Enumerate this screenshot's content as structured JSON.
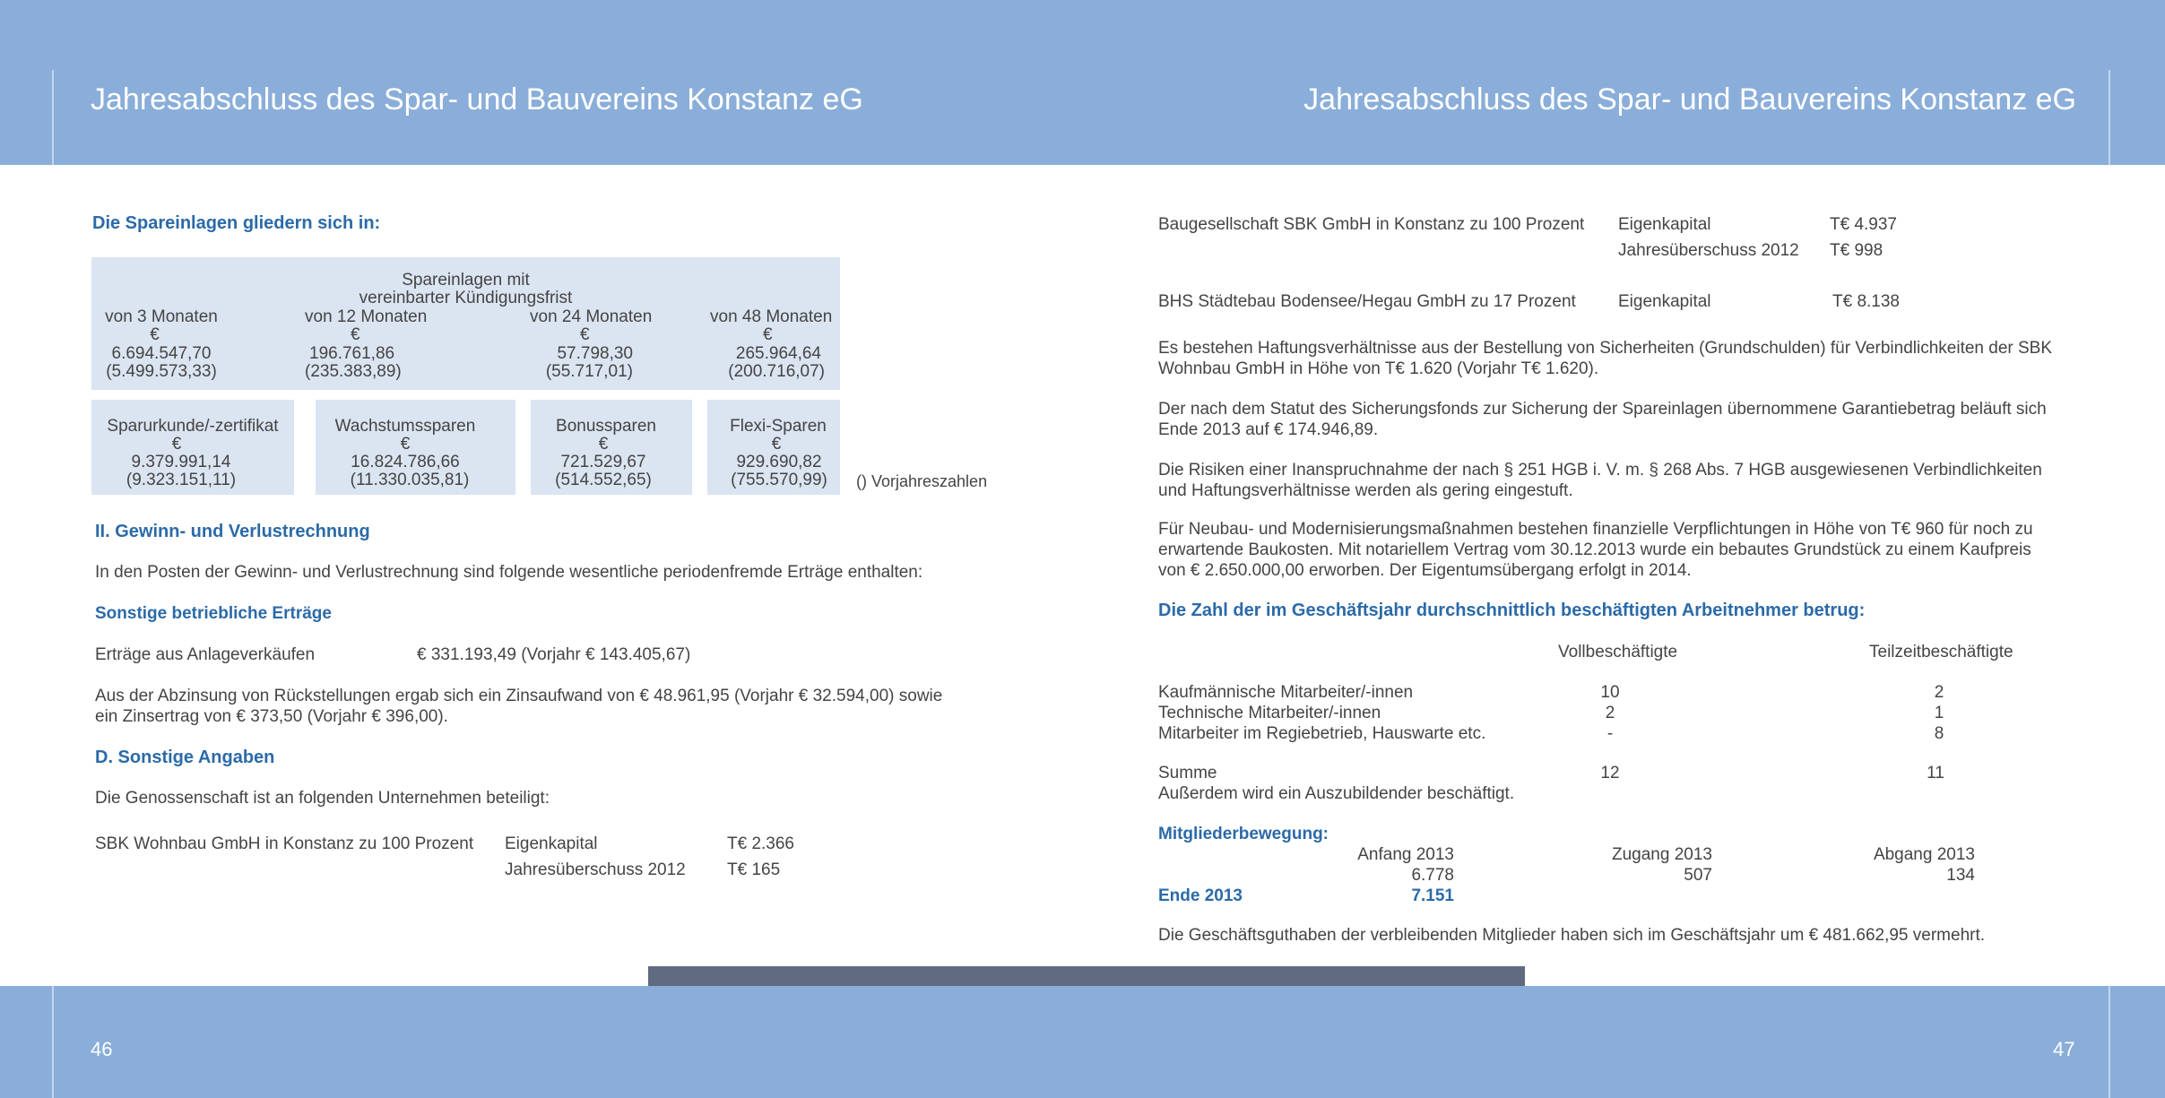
{
  "header": {
    "left_title": "Jahresabschluss des Spar- und Bauvereins Konstanz eG",
    "right_title": "Jahresabschluss des Spar- und Bauvereins Konstanz eG"
  },
  "footer": {
    "left_page": "46",
    "right_page": "47"
  },
  "left": {
    "spareinlagen_heading": "Die Spareinlagen gliedern sich in:",
    "table1": {
      "caption_line1": "Spareinlagen mit",
      "caption_line2": "vereinbarter Kündigungsfrist",
      "columns": [
        {
          "label": "von 3 Monaten",
          "currency": "€",
          "value": "6.694.547,70",
          "prior": "(5.499.573,33)"
        },
        {
          "label": "von 12 Monaten",
          "currency": "€",
          "value": "196.761,86",
          "prior": "(235.383,89)"
        },
        {
          "label": "von 24 Monaten",
          "currency": "€",
          "value": "57.798,30",
          "prior": "(55.717,01)"
        },
        {
          "label": "von 48 Monaten",
          "currency": "€",
          "value": "265.964,64",
          "prior": "(200.716,07)"
        }
      ]
    },
    "table2": [
      {
        "label": "Sparurkunde/-zertifikat",
        "currency": "€",
        "value": "9.379.991,14",
        "prior": "(9.323.151,11)"
      },
      {
        "label": "Wachstumssparen",
        "currency": "€",
        "value": "16.824.786,66",
        "prior": "(11.330.035,81)"
      },
      {
        "label": "Bonussparen",
        "currency": "€",
        "value": "721.529,67",
        "prior": "(514.552,65)"
      },
      {
        "label": "Flexi-Sparen",
        "currency": "€",
        "value": "929.690,82",
        "prior": "(755.570,99)"
      }
    ],
    "prior_note": "() Vorjahreszahlen",
    "guv_heading": "II. Gewinn- und Verlustrechnung",
    "guv_intro": "In den Posten der Gewinn- und Verlustrechnung sind folgende wesentliche periodenfremde Erträge enthalten:",
    "sonstige_heading": "Sonstige betriebliche Erträge",
    "ertraege_label": "Erträge aus Anlageverkäufen",
    "ertraege_value": "€ 331.193,49  (Vorjahr € 143.405,67)",
    "abzinsung_line1": "Aus der Abzinsung von Rückstellungen ergab sich ein Zinsaufwand von € 48.961,95 (Vorjahr € 32.594,00) sowie",
    "abzinsung_line2": "ein Zinsertrag von € 373,50 (Vorjahr € 396,00).",
    "d_heading": "D. Sonstige Angaben",
    "beteiligt_intro": "Die Genossenschaft ist an folgenden Unternehmen beteiligt:",
    "sbk": {
      "name": "SBK Wohnbau GmbH in Konstanz zu 100 Prozent",
      "row1_label": "Eigenkapital",
      "row1_value": "T€ 2.366",
      "row2_label": "Jahresüberschuss 2012",
      "row2_value": "T€ 165"
    }
  },
  "right": {
    "baugesellschaft": {
      "name": "Baugesellschaft SBK GmbH in Konstanz zu 100 Prozent",
      "row1_label": "Eigenkapital",
      "row1_value": "T€ 4.937",
      "row2_label": "Jahresüberschuss 2012",
      "row2_value": "T€ 998"
    },
    "bhs": {
      "name": "BHS Städtebau Bodensee/Hegau GmbH zu 17 Prozent",
      "label": "Eigenkapital",
      "value": "T€ 8.138"
    },
    "p1_line1": "Es bestehen Haftungsverhältnisse aus der Bestellung von Sicherheiten (Grundschulden) für Verbindlichkeiten der SBK",
    "p1_line2": "Wohnbau GmbH in Höhe von T€ 1.620 (Vorjahr T€ 1.620).",
    "p2_line1": "Der nach dem Statut des Sicherungsfonds zur Sicherung der Spareinlagen übernommene Garantiebetrag beläuft sich",
    "p2_line2": "Ende 2013 auf € 174.946,89.",
    "p3_line1": "Die Risiken einer Inanspruchnahme der nach § 251 HGB i. V. m. § 268 Abs. 7 HGB ausgewiesenen Verbindlichkeiten",
    "p3_line2": "und Haftungsverhältnisse werden als gering eingestuft.",
    "p4_line1": "Für Neubau- und Modernisierungsmaßnahmen bestehen finanzielle Verpflichtungen in Höhe von T€ 960 für noch zu",
    "p4_line2": "erwartende Baukosten. Mit notariellem Vertrag vom 30.12.2013 wurde ein bebautes Grundstück zu einem Kaufpreis",
    "p4_line3": "von € 2.650.000,00 erworben. Der Eigentumsübergang erfolgt in 2014.",
    "arbeitnehmer_heading": "Die Zahl der im Geschäftsjahr durchschnittlich beschäftigten Arbeitnehmer betrug:",
    "staff_headers": {
      "full": "Vollbeschäftigte",
      "part": "Teilzeitbeschäftigte"
    },
    "staff_rows": [
      {
        "label": "Kaufmännische Mitarbeiter/-innen",
        "full": "10",
        "part": "2"
      },
      {
        "label": "Technische Mitarbeiter/-innen",
        "full": "2",
        "part": "1"
      },
      {
        "label": "Mitarbeiter im Regiebetrieb, Hauswarte etc.",
        "full": "-",
        "part": "8"
      }
    ],
    "summe": {
      "label": "Summe",
      "full": "12",
      "part": "11"
    },
    "azubi": "Außerdem wird ein Auszubildender beschäftigt.",
    "mitglieder_heading": "Mitgliederbewegung:",
    "mitglieder": {
      "h1": "Anfang 2013",
      "h2": "Zugang 2013",
      "h3": "Abgang 2013",
      "v1": "6.778",
      "v2": "507",
      "v3": "134",
      "end_label": "Ende 2013",
      "end_value": "7.151"
    },
    "guthaben": "Die Geschäftsguthaben der verbleibenden Mitglieder haben sich im Geschäftsjahr um € 481.662,95 vermehrt."
  }
}
